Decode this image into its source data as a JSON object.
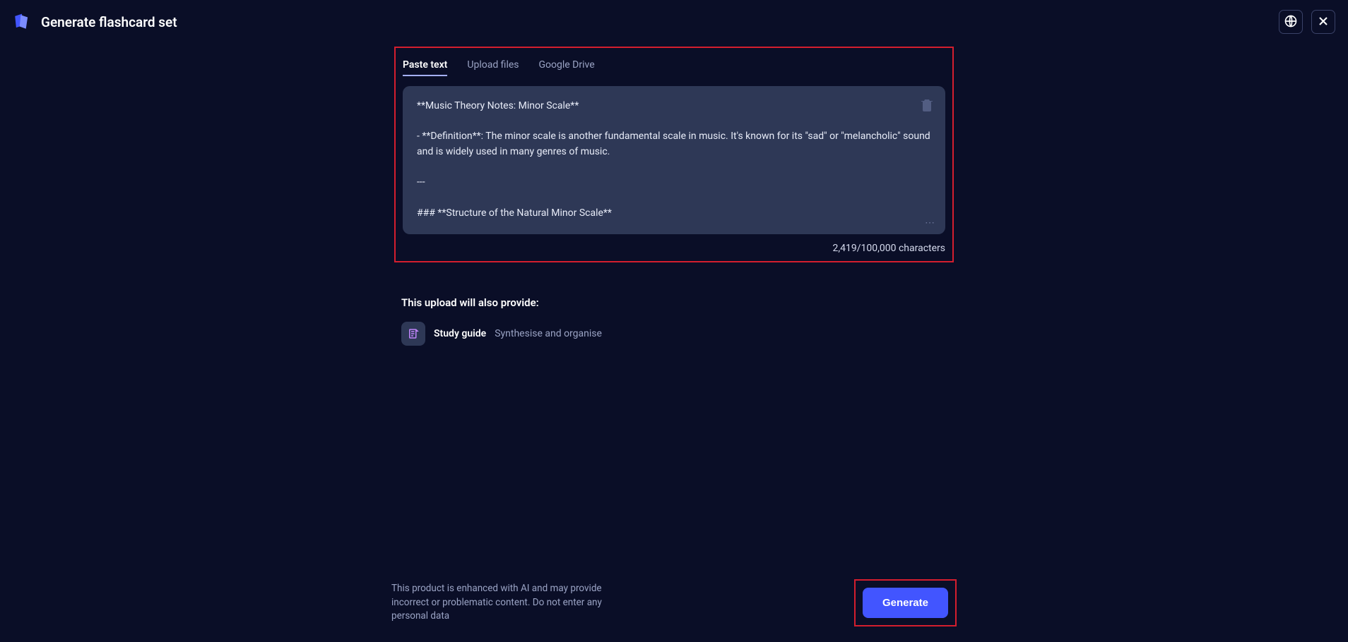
{
  "header": {
    "title": "Generate flashcard set"
  },
  "tabs": [
    {
      "label": "Paste text",
      "active": true
    },
    {
      "label": "Upload files",
      "active": false
    },
    {
      "label": "Google Drive",
      "active": false
    }
  ],
  "textarea": {
    "content": "**Music Theory Notes: Minor Scale**\n\n- **Definition**: The minor scale is another fundamental scale in music. It's known for its \"sad\" or \"melancholic\" sound and is widely used in many genres of music.\n\n---\n\n### **Structure of the Natural Minor Scale**"
  },
  "char_count": "2,419/100,000 characters",
  "provide": {
    "heading": "This upload will also provide:",
    "items": [
      {
        "label": "Study guide",
        "desc": "Synthesise and organise"
      }
    ]
  },
  "footer": {
    "disclaimer": "This product is enhanced with AI and may provide incorrect or problematic content. Do not enter any personal data",
    "generate_label": "Generate"
  }
}
